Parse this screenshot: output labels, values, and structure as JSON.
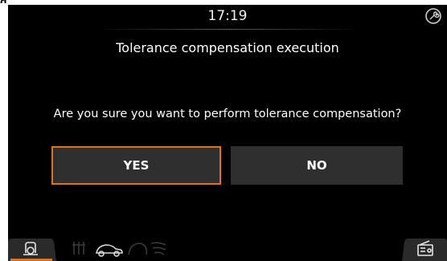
{
  "caption": "g",
  "header": {
    "time": "17:19",
    "status_icon": "service-wrench-icon"
  },
  "dialog": {
    "title": "Tolerance compensation execution",
    "question": "Are you sure you want to perform tolerance compensation?",
    "yes_label": "YES",
    "no_label": "NO"
  },
  "bottom_bar": {
    "left_tab_icon": "vehicle-settings-icon",
    "middle_icons": [
      "fan-icon",
      "car-icon",
      "wiper-icon"
    ],
    "right_tab_icon": "radio-icon"
  },
  "colors": {
    "accent": "#e2711d",
    "button_bg": "#2f2f2f",
    "screen_bg": "#000000"
  }
}
